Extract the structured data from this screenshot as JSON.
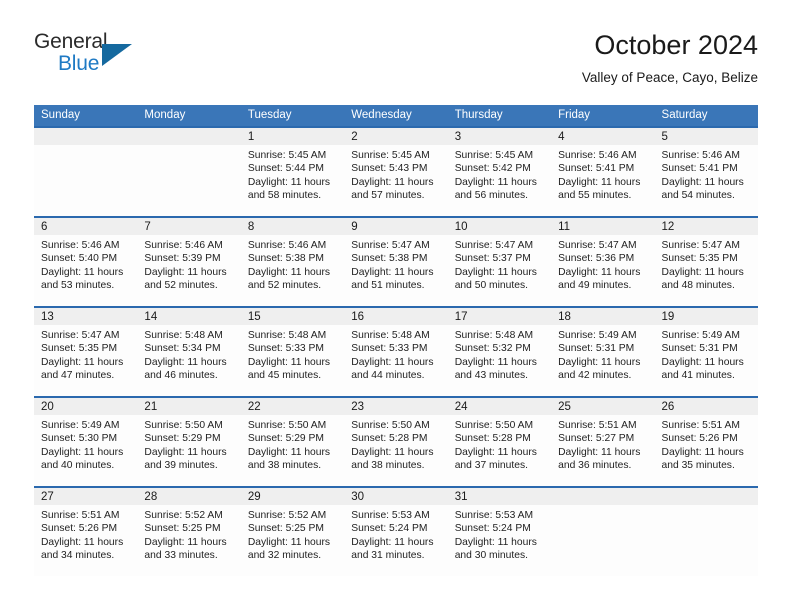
{
  "brand": {
    "name_top": "General",
    "name_bottom": "Blue",
    "accent_color": "#1f7ac4",
    "triangle_color": "#15699f"
  },
  "header": {
    "title": "October 2024",
    "subtitle": "Valley of Peace, Cayo, Belize"
  },
  "theme": {
    "header_blue": "#3a76b8",
    "rule_blue": "#2b69ae",
    "daynum_band": "#efefef"
  },
  "weekdays": [
    "Sunday",
    "Monday",
    "Tuesday",
    "Wednesday",
    "Thursday",
    "Friday",
    "Saturday"
  ],
  "weeks": [
    [
      {
        "day": "",
        "sunrise": "",
        "sunset": "",
        "daylight_1": "",
        "daylight_2": ""
      },
      {
        "day": "",
        "sunrise": "",
        "sunset": "",
        "daylight_1": "",
        "daylight_2": ""
      },
      {
        "day": "1",
        "sunrise": "Sunrise: 5:45 AM",
        "sunset": "Sunset: 5:44 PM",
        "daylight_1": "Daylight: 11 hours",
        "daylight_2": "and 58 minutes."
      },
      {
        "day": "2",
        "sunrise": "Sunrise: 5:45 AM",
        "sunset": "Sunset: 5:43 PM",
        "daylight_1": "Daylight: 11 hours",
        "daylight_2": "and 57 minutes."
      },
      {
        "day": "3",
        "sunrise": "Sunrise: 5:45 AM",
        "sunset": "Sunset: 5:42 PM",
        "daylight_1": "Daylight: 11 hours",
        "daylight_2": "and 56 minutes."
      },
      {
        "day": "4",
        "sunrise": "Sunrise: 5:46 AM",
        "sunset": "Sunset: 5:41 PM",
        "daylight_1": "Daylight: 11 hours",
        "daylight_2": "and 55 minutes."
      },
      {
        "day": "5",
        "sunrise": "Sunrise: 5:46 AM",
        "sunset": "Sunset: 5:41 PM",
        "daylight_1": "Daylight: 11 hours",
        "daylight_2": "and 54 minutes."
      }
    ],
    [
      {
        "day": "6",
        "sunrise": "Sunrise: 5:46 AM",
        "sunset": "Sunset: 5:40 PM",
        "daylight_1": "Daylight: 11 hours",
        "daylight_2": "and 53 minutes."
      },
      {
        "day": "7",
        "sunrise": "Sunrise: 5:46 AM",
        "sunset": "Sunset: 5:39 PM",
        "daylight_1": "Daylight: 11 hours",
        "daylight_2": "and 52 minutes."
      },
      {
        "day": "8",
        "sunrise": "Sunrise: 5:46 AM",
        "sunset": "Sunset: 5:38 PM",
        "daylight_1": "Daylight: 11 hours",
        "daylight_2": "and 52 minutes."
      },
      {
        "day": "9",
        "sunrise": "Sunrise: 5:47 AM",
        "sunset": "Sunset: 5:38 PM",
        "daylight_1": "Daylight: 11 hours",
        "daylight_2": "and 51 minutes."
      },
      {
        "day": "10",
        "sunrise": "Sunrise: 5:47 AM",
        "sunset": "Sunset: 5:37 PM",
        "daylight_1": "Daylight: 11 hours",
        "daylight_2": "and 50 minutes."
      },
      {
        "day": "11",
        "sunrise": "Sunrise: 5:47 AM",
        "sunset": "Sunset: 5:36 PM",
        "daylight_1": "Daylight: 11 hours",
        "daylight_2": "and 49 minutes."
      },
      {
        "day": "12",
        "sunrise": "Sunrise: 5:47 AM",
        "sunset": "Sunset: 5:35 PM",
        "daylight_1": "Daylight: 11 hours",
        "daylight_2": "and 48 minutes."
      }
    ],
    [
      {
        "day": "13",
        "sunrise": "Sunrise: 5:47 AM",
        "sunset": "Sunset: 5:35 PM",
        "daylight_1": "Daylight: 11 hours",
        "daylight_2": "and 47 minutes."
      },
      {
        "day": "14",
        "sunrise": "Sunrise: 5:48 AM",
        "sunset": "Sunset: 5:34 PM",
        "daylight_1": "Daylight: 11 hours",
        "daylight_2": "and 46 minutes."
      },
      {
        "day": "15",
        "sunrise": "Sunrise: 5:48 AM",
        "sunset": "Sunset: 5:33 PM",
        "daylight_1": "Daylight: 11 hours",
        "daylight_2": "and 45 minutes."
      },
      {
        "day": "16",
        "sunrise": "Sunrise: 5:48 AM",
        "sunset": "Sunset: 5:33 PM",
        "daylight_1": "Daylight: 11 hours",
        "daylight_2": "and 44 minutes."
      },
      {
        "day": "17",
        "sunrise": "Sunrise: 5:48 AM",
        "sunset": "Sunset: 5:32 PM",
        "daylight_1": "Daylight: 11 hours",
        "daylight_2": "and 43 minutes."
      },
      {
        "day": "18",
        "sunrise": "Sunrise: 5:49 AM",
        "sunset": "Sunset: 5:31 PM",
        "daylight_1": "Daylight: 11 hours",
        "daylight_2": "and 42 minutes."
      },
      {
        "day": "19",
        "sunrise": "Sunrise: 5:49 AM",
        "sunset": "Sunset: 5:31 PM",
        "daylight_1": "Daylight: 11 hours",
        "daylight_2": "and 41 minutes."
      }
    ],
    [
      {
        "day": "20",
        "sunrise": "Sunrise: 5:49 AM",
        "sunset": "Sunset: 5:30 PM",
        "daylight_1": "Daylight: 11 hours",
        "daylight_2": "and 40 minutes."
      },
      {
        "day": "21",
        "sunrise": "Sunrise: 5:50 AM",
        "sunset": "Sunset: 5:29 PM",
        "daylight_1": "Daylight: 11 hours",
        "daylight_2": "and 39 minutes."
      },
      {
        "day": "22",
        "sunrise": "Sunrise: 5:50 AM",
        "sunset": "Sunset: 5:29 PM",
        "daylight_1": "Daylight: 11 hours",
        "daylight_2": "and 38 minutes."
      },
      {
        "day": "23",
        "sunrise": "Sunrise: 5:50 AM",
        "sunset": "Sunset: 5:28 PM",
        "daylight_1": "Daylight: 11 hours",
        "daylight_2": "and 38 minutes."
      },
      {
        "day": "24",
        "sunrise": "Sunrise: 5:50 AM",
        "sunset": "Sunset: 5:28 PM",
        "daylight_1": "Daylight: 11 hours",
        "daylight_2": "and 37 minutes."
      },
      {
        "day": "25",
        "sunrise": "Sunrise: 5:51 AM",
        "sunset": "Sunset: 5:27 PM",
        "daylight_1": "Daylight: 11 hours",
        "daylight_2": "and 36 minutes."
      },
      {
        "day": "26",
        "sunrise": "Sunrise: 5:51 AM",
        "sunset": "Sunset: 5:26 PM",
        "daylight_1": "Daylight: 11 hours",
        "daylight_2": "and 35 minutes."
      }
    ],
    [
      {
        "day": "27",
        "sunrise": "Sunrise: 5:51 AM",
        "sunset": "Sunset: 5:26 PM",
        "daylight_1": "Daylight: 11 hours",
        "daylight_2": "and 34 minutes."
      },
      {
        "day": "28",
        "sunrise": "Sunrise: 5:52 AM",
        "sunset": "Sunset: 5:25 PM",
        "daylight_1": "Daylight: 11 hours",
        "daylight_2": "and 33 minutes."
      },
      {
        "day": "29",
        "sunrise": "Sunrise: 5:52 AM",
        "sunset": "Sunset: 5:25 PM",
        "daylight_1": "Daylight: 11 hours",
        "daylight_2": "and 32 minutes."
      },
      {
        "day": "30",
        "sunrise": "Sunrise: 5:53 AM",
        "sunset": "Sunset: 5:24 PM",
        "daylight_1": "Daylight: 11 hours",
        "daylight_2": "and 31 minutes."
      },
      {
        "day": "31",
        "sunrise": "Sunrise: 5:53 AM",
        "sunset": "Sunset: 5:24 PM",
        "daylight_1": "Daylight: 11 hours",
        "daylight_2": "and 30 minutes."
      },
      {
        "day": "",
        "sunrise": "",
        "sunset": "",
        "daylight_1": "",
        "daylight_2": ""
      },
      {
        "day": "",
        "sunrise": "",
        "sunset": "",
        "daylight_1": "",
        "daylight_2": ""
      }
    ]
  ]
}
